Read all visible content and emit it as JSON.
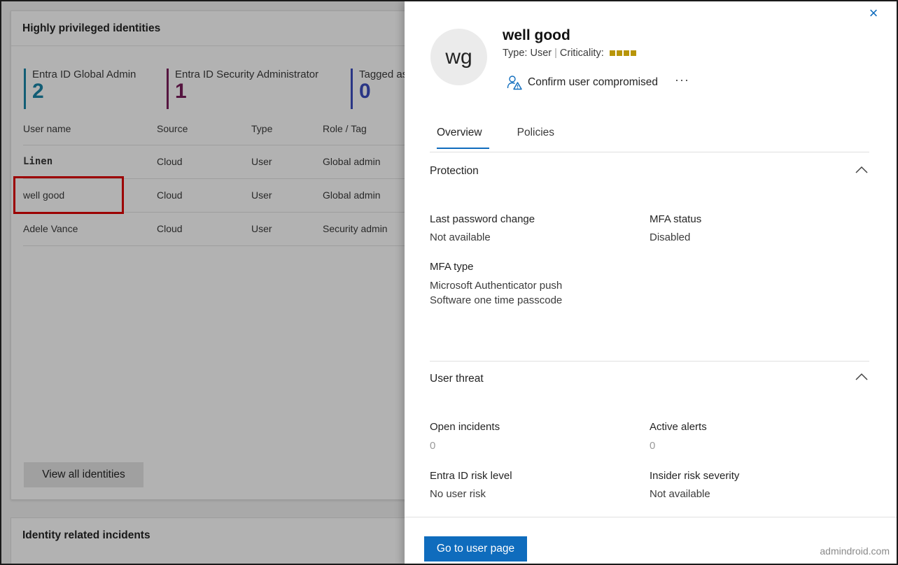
{
  "background": {
    "card_title": "Highly privileged identities",
    "stats": [
      {
        "label": "Entra ID Global Admin",
        "value": "2"
      },
      {
        "label": "Entra ID Security Administrator",
        "value": "1"
      },
      {
        "label": "Tagged as",
        "value": "0"
      }
    ],
    "table": {
      "headers": [
        "User name",
        "Source",
        "Type",
        "Role / Tag"
      ],
      "rows": [
        {
          "user": "Linen",
          "source": "Cloud",
          "type": "User",
          "role": "Global admin"
        },
        {
          "user": "well good",
          "source": "Cloud",
          "type": "User",
          "role": "Global admin"
        },
        {
          "user": "Adele Vance",
          "source": "Cloud",
          "type": "User",
          "role": "Security admin"
        }
      ]
    },
    "view_all_label": "View all identities",
    "card2_title": "Identity related incidents"
  },
  "panel": {
    "avatar_initials": "wg",
    "name": "well good",
    "type_label": "Type: User",
    "criticality_label": "Criticality:",
    "criticality_color": "#b89508",
    "confirm_label": "Confirm user compromised",
    "more_label": "···",
    "close_icon": "×",
    "tabs": [
      "Overview",
      "Policies"
    ],
    "protection": {
      "title": "Protection",
      "last_password_label": "Last password change",
      "last_password_value": "Not available",
      "mfa_status_label": "MFA status",
      "mfa_status_value": "Disabled",
      "mfa_type_label": "MFA type",
      "mfa_type_values": [
        "Microsoft Authenticator push",
        "Software one time passcode"
      ]
    },
    "user_threat": {
      "title": "User threat",
      "open_incidents_label": "Open incidents",
      "open_incidents_value": "0",
      "active_alerts_label": "Active alerts",
      "active_alerts_value": "0",
      "risk_level_label": "Entra ID risk level",
      "risk_level_value": "No user risk",
      "insider_label": "Insider risk severity",
      "insider_value": "Not available"
    },
    "go_to_user_label": "Go to user page",
    "accent_color": "#0f6cbd"
  },
  "watermark": "admindroid.com"
}
